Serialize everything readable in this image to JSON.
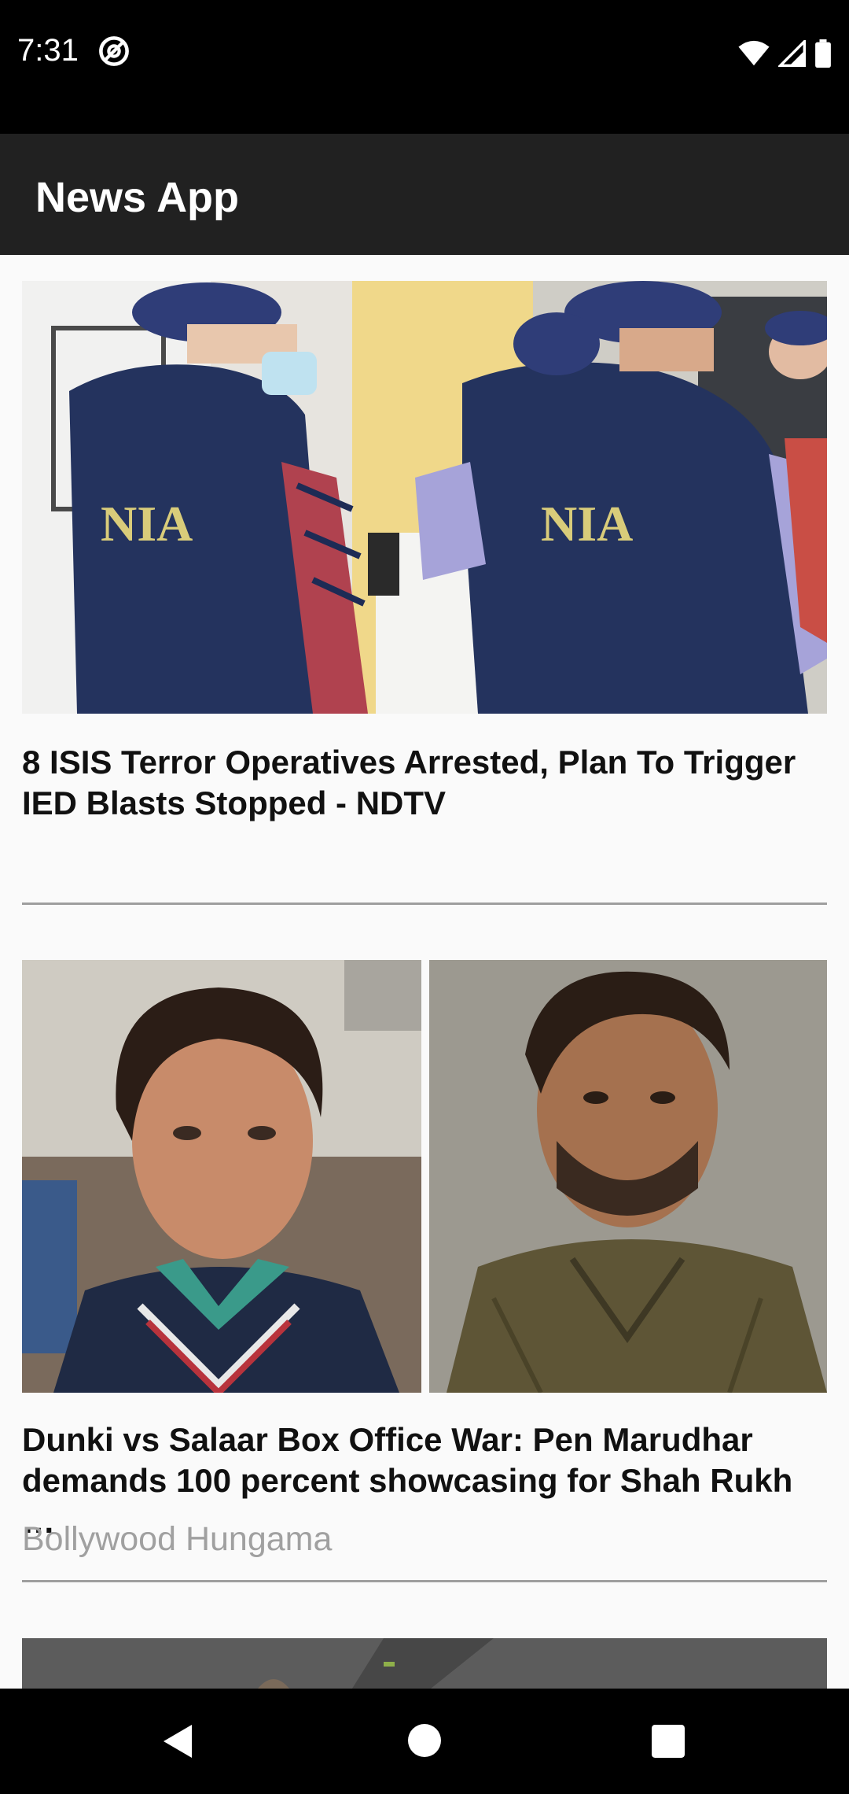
{
  "status_bar": {
    "time": "7:31",
    "icons": [
      "at-sign-icon",
      "wifi-icon",
      "signal-icon",
      "battery-icon"
    ]
  },
  "app_bar": {
    "title": "News App",
    "background": "#212121"
  },
  "articles": [
    {
      "title": "8 ISIS Terror Operatives Arrested, Plan To Trigger\nIED Blasts Stopped - NDTV",
      "source": "",
      "image": "NIA officers in navy vests"
    },
    {
      "title": "Dunki vs Salaar Box Office War: Pen Marudhar\ndemands 100 percent showcasing for Shah Rukh …",
      "source": "Bollywood Hungama",
      "image": "two actor portraits side by side"
    }
  ],
  "nav_bar": {
    "buttons": [
      "back-icon",
      "home-icon",
      "recents-icon"
    ]
  }
}
